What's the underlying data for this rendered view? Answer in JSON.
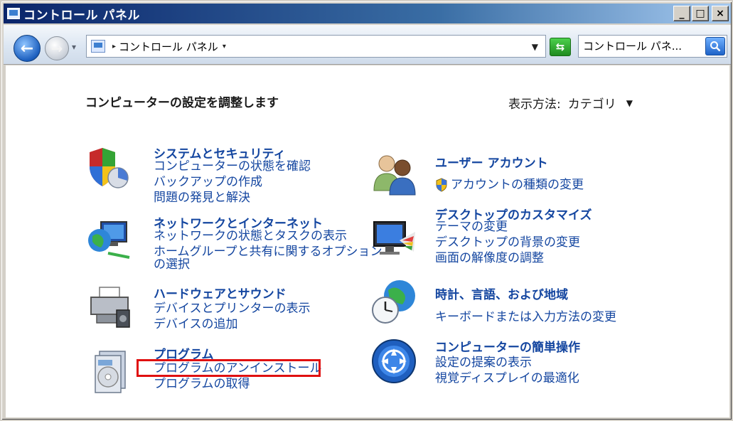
{
  "window": {
    "title": "コントロール パネル",
    "caption": {
      "minimize": "_",
      "maximize": "□",
      "close": "×"
    }
  },
  "navbar": {
    "back_icon": "back-arrow-icon",
    "forward_icon": "forward-arrow-icon",
    "address_separator": "▸",
    "address_text": "コントロール パネル",
    "address_dropdown": "▾",
    "search_placeholder": "コントロール パネ..."
  },
  "content": {
    "heading": "コンピューターの設定を調整します",
    "view_by_label": "表示方法:",
    "view_by_value": "カテゴリ",
    "view_by_arrow": "▼",
    "categories": [
      {
        "title": "システムとセキュリティ",
        "icon": "shield-pie-icon",
        "links": [
          "コンピューターの状態を確認",
          "バックアップの作成",
          "問題の発見と解決"
        ]
      },
      {
        "title": "ネットワークとインターネット",
        "icon": "network-globe-icon",
        "links": [
          "ネットワークの状態とタスクの表示",
          "ホームグループと共有に関するオプション",
          "の選択"
        ]
      },
      {
        "title": "ハードウェアとサウンド",
        "icon": "printer-icon",
        "links": [
          "デバイスとプリンターの表示",
          "デバイスの追加"
        ]
      },
      {
        "title": "プログラム",
        "icon": "programs-disc-icon",
        "links": [
          "プログラムのアンインストール",
          "プログラムの取得"
        ]
      },
      {
        "title": "ユーザー アカウント",
        "icon": "users-icon",
        "links": [
          "アカウントの種類の変更"
        ]
      },
      {
        "title": "デスクトップのカスタマイズ",
        "icon": "monitor-palette-icon",
        "links": [
          "テーマの変更",
          "デスクトップの背景の変更",
          "画面の解像度の調整"
        ]
      },
      {
        "title": "時計、言語、および地域",
        "icon": "clock-globe-icon",
        "links": [
          "キーボードまたは入力方法の変更"
        ]
      },
      {
        "title": "コンピューターの簡単操作",
        "icon": "ease-of-access-icon",
        "links": [
          "設定の提案の表示",
          "視覚ディスプレイの最適化"
        ]
      }
    ]
  },
  "colors": {
    "link": "#1446a0",
    "highlight": "#e01010"
  }
}
